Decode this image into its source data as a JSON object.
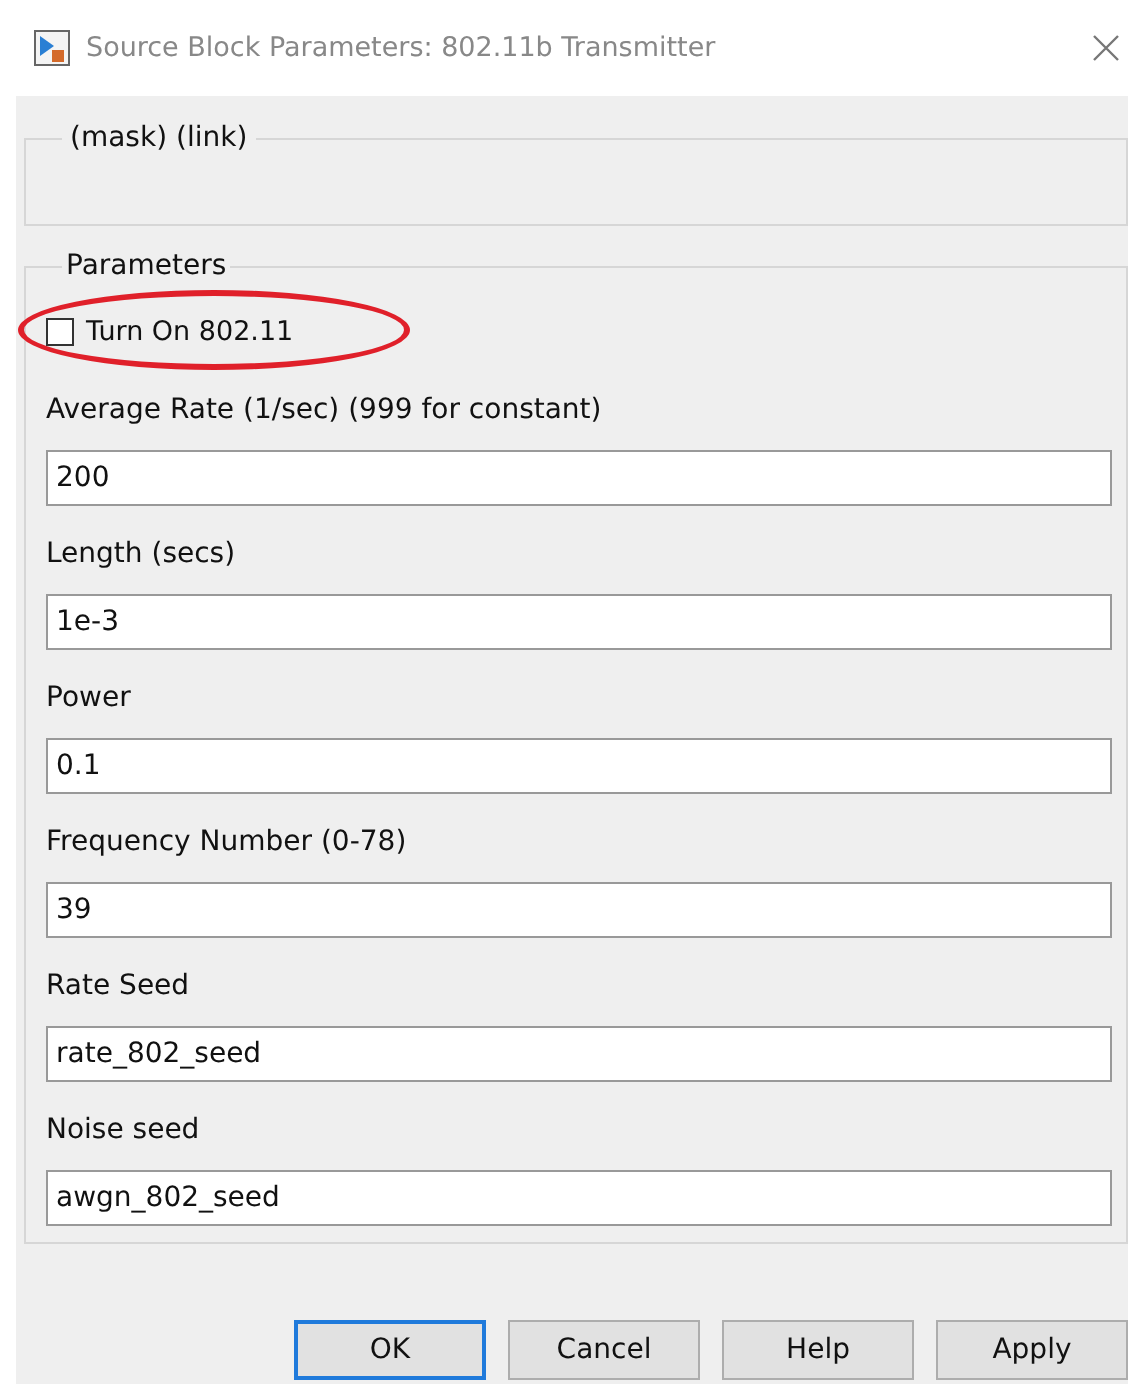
{
  "window": {
    "title": "Source Block Parameters: 802.11b Transmitter"
  },
  "mask_group": {
    "title": "(mask) (link)"
  },
  "parameters": {
    "title": "Parameters",
    "checkbox": {
      "label": "Turn On 802.11",
      "checked": false,
      "highlighted": true
    },
    "fields": [
      {
        "label": "Average Rate (1/sec) (999 for constant)",
        "value": "200"
      },
      {
        "label": "Length (secs)",
        "value": "1e-3"
      },
      {
        "label": "Power",
        "value": "0.1"
      },
      {
        "label": "Frequency Number (0-78)",
        "value": "39"
      },
      {
        "label": "Rate Seed",
        "value": "rate_802_seed"
      },
      {
        "label": "Noise seed",
        "value": "awgn_802_seed"
      }
    ]
  },
  "buttons": [
    {
      "label": "OK",
      "default": true
    },
    {
      "label": "Cancel",
      "default": false
    },
    {
      "label": "Help",
      "default": false
    },
    {
      "label": "Apply",
      "default": false
    }
  ]
}
